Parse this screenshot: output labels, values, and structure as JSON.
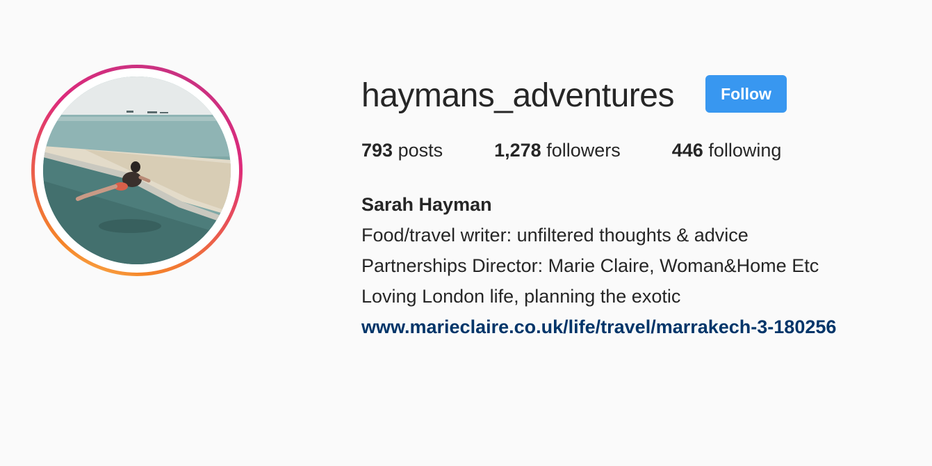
{
  "profile": {
    "username": "haymans_adventures",
    "follow_label": "Follow",
    "stats": {
      "posts_count": "793",
      "posts_label": "posts",
      "followers_count": "1,278",
      "followers_label": "followers",
      "following_count": "446",
      "following_label": "following"
    },
    "bio": {
      "full_name": "Sarah Hayman",
      "lines": [
        "Food/travel writer: unfiltered thoughts & advice",
        "Partnerships Director: Marie Claire, Woman&Home Etc",
        "Loving London life, planning the exotic"
      ],
      "link": "www.marieclaire.co.uk/life/travel/marrakech-3-180256"
    }
  },
  "colors": {
    "follow_button": "#3897f0",
    "link": "#003569",
    "background": "#fafafa",
    "ring_start": "#c13584",
    "ring_end": "#f58529"
  }
}
